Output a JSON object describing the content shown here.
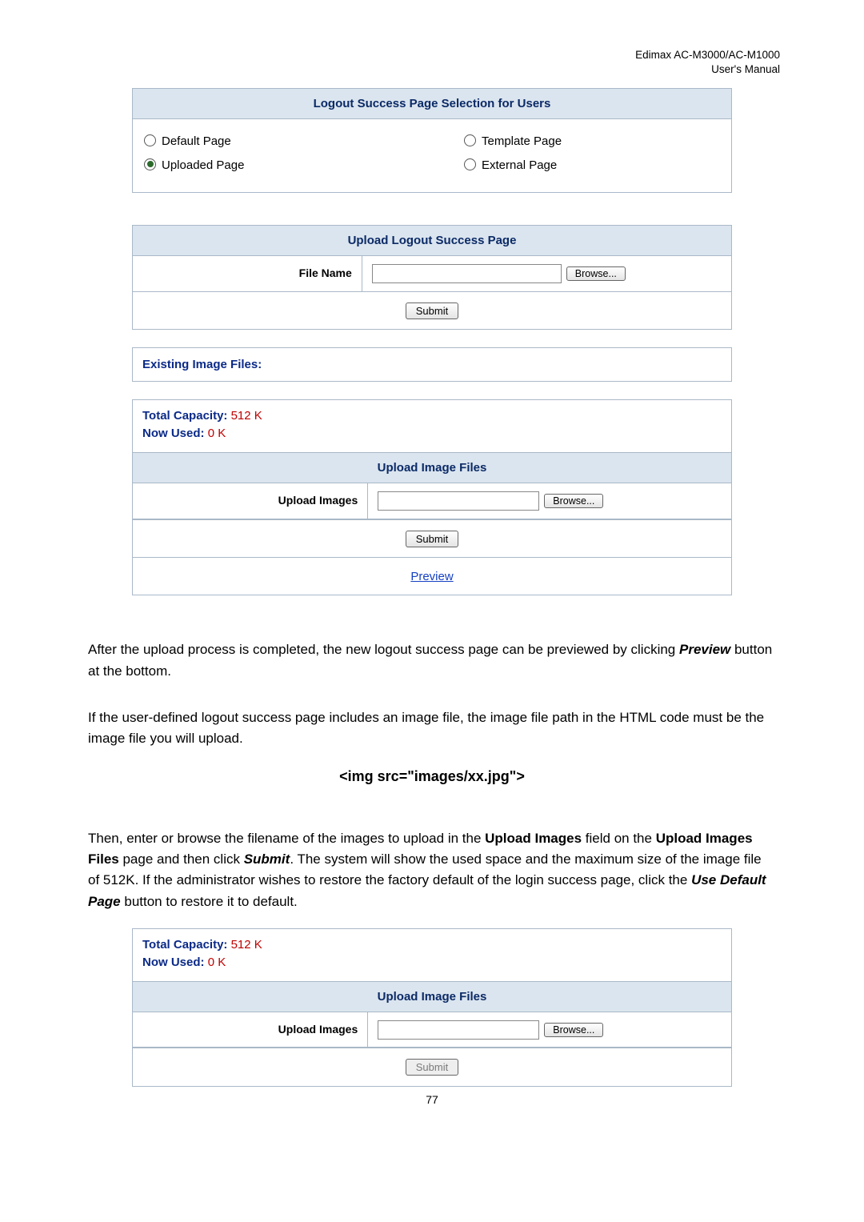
{
  "header": {
    "line1": "Edimax  AC-M3000/AC-M1000",
    "line2": "User's  Manual"
  },
  "selection": {
    "title": "Logout Success Page Selection for Users",
    "left": [
      {
        "label": "Default Page",
        "checked": false
      },
      {
        "label": "Uploaded Page",
        "checked": true
      }
    ],
    "right": [
      {
        "label": "Template Page",
        "checked": false
      },
      {
        "label": "External Page",
        "checked": false
      }
    ]
  },
  "upload_logout": {
    "title": "Upload Logout Success Page",
    "row_label": "File Name",
    "browse": "Browse...",
    "submit": "Submit"
  },
  "existing_label": "Existing Image Files:",
  "capacity": {
    "total_label": "Total Capacity: ",
    "total_value": "512 K",
    "used_label": "Now Used: ",
    "used_value": "0 K"
  },
  "upload_images": {
    "title": "Upload Image Files",
    "row_label": "Upload Images",
    "browse": "Browse...",
    "submit": "Submit",
    "preview": "Preview"
  },
  "para1": {
    "t1": "After the upload process is completed, the new logout success page can be previewed by clicking ",
    "preview": "Preview",
    "t2": " button at the bottom."
  },
  "para2": "If the user-defined logout success page includes an image file, the image file path in the HTML code must be the image file you will upload.",
  "code_line": "<img src=\"images/xx.jpg\">",
  "para3": {
    "t1": "Then, enter or browse the filename of the images to upload in the ",
    "b1": "Upload Images",
    "t2": " field on the ",
    "b2": "Upload Images Files",
    "t3": " page and then click ",
    "ib1": "Submit",
    "t4": ". The system will show the used space and the maximum size of the image file of 512K. If the administrator wishes to restore the factory default of the login success page, click the ",
    "ib2": "Use Default Page",
    "t5": " button to restore it to default."
  },
  "lower": {
    "title": "Upload Image Files",
    "row_label": "Upload Images",
    "browse": "Browse...",
    "submit": "Submit"
  },
  "page_number": "77"
}
